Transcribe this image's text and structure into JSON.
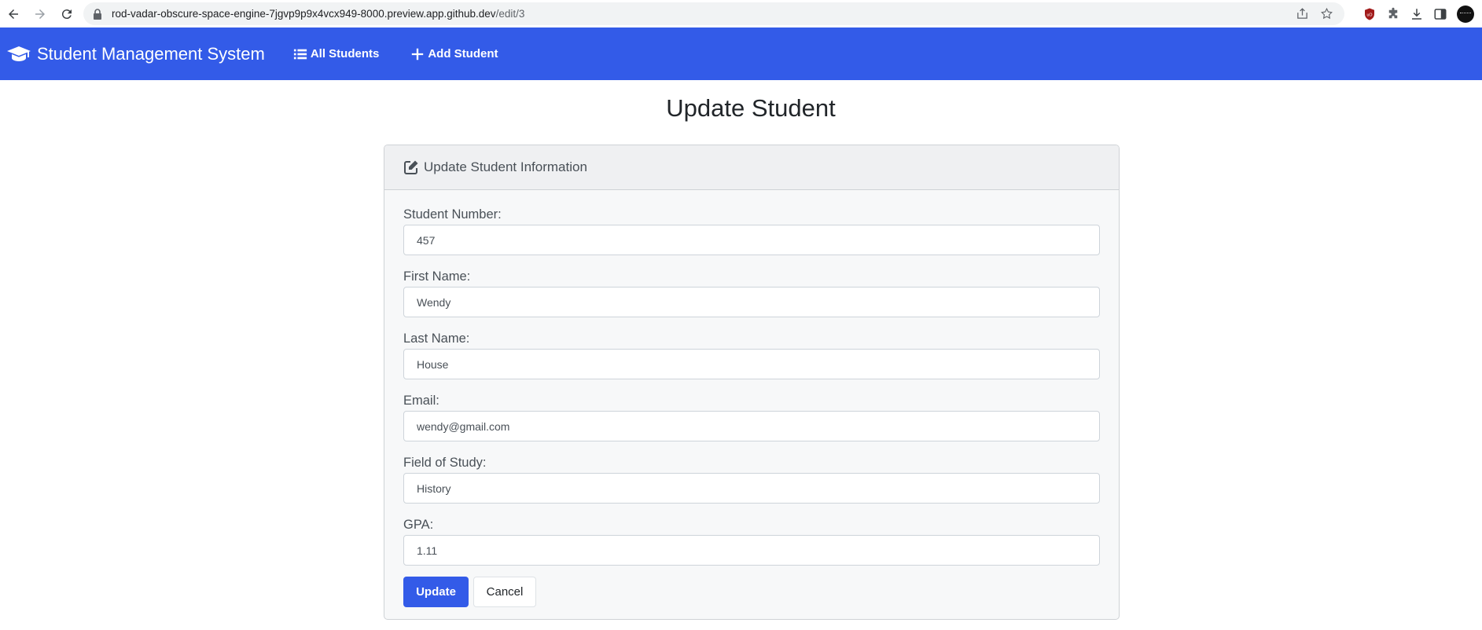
{
  "browser": {
    "url_host": "rod-vadar-obscure-space-engine-7jgvp9p9x4vcx949-8000.preview.app.github.dev",
    "url_path": "/edit/3"
  },
  "navbar": {
    "brand": "Student Management System",
    "links": [
      {
        "label": "All Students",
        "icon": "list-icon"
      },
      {
        "label": "Add Student",
        "icon": "plus-icon"
      }
    ],
    "bg_color": "#335be8"
  },
  "page": {
    "title": "Update Student"
  },
  "card": {
    "header": "Update Student Information",
    "fields": [
      {
        "label": "Student Number:",
        "value": "457"
      },
      {
        "label": "First Name:",
        "value": "Wendy"
      },
      {
        "label": "Last Name:",
        "value": "House"
      },
      {
        "label": "Email:",
        "value": "wendy@gmail.com"
      },
      {
        "label": "Field of Study:",
        "value": "History"
      },
      {
        "label": "GPA:",
        "value": "1.11"
      }
    ],
    "update_label": "Update",
    "cancel_label": "Cancel"
  }
}
